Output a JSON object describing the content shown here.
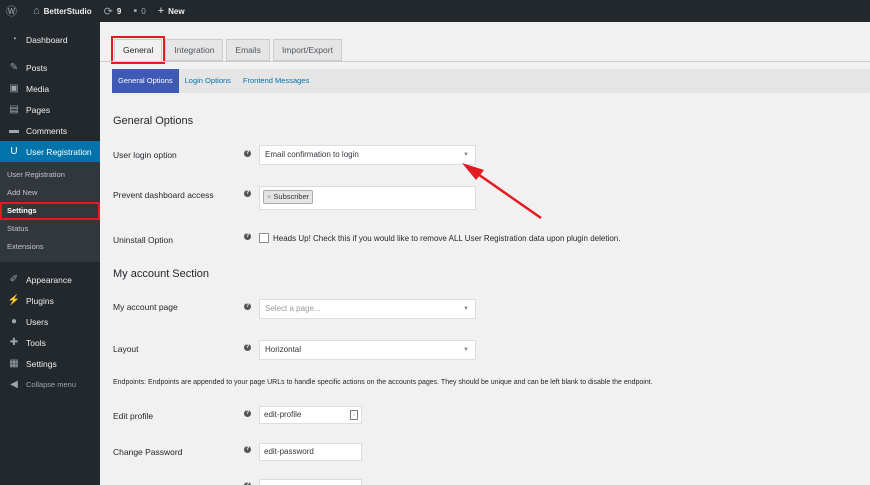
{
  "adminbar": {
    "site_name": "BetterStudio",
    "updates_count": "9",
    "comments_count": "0",
    "new_label": "New"
  },
  "sidebar": {
    "items": [
      {
        "label": "Dashboard",
        "icon": "dashboard-icon"
      },
      {
        "label": "Posts",
        "icon": "pin-icon"
      },
      {
        "label": "Media",
        "icon": "media-icon"
      },
      {
        "label": "Pages",
        "icon": "page-icon"
      },
      {
        "label": "Comments",
        "icon": "comment-icon"
      },
      {
        "label": "User Registration",
        "icon": "ur-icon"
      },
      {
        "label": "Appearance",
        "icon": "brush-icon"
      },
      {
        "label": "Plugins",
        "icon": "plug-icon"
      },
      {
        "label": "Users",
        "icon": "user-icon"
      },
      {
        "label": "Tools",
        "icon": "wrench-icon"
      },
      {
        "label": "Settings",
        "icon": "settings-icon"
      }
    ],
    "submenu": [
      "User Registration",
      "Add New",
      "Settings",
      "Status",
      "Extensions"
    ],
    "collapse_label": "Collapse menu"
  },
  "tabs": [
    "General",
    "Integration",
    "Emails",
    "Import/Export"
  ],
  "subnav": [
    "General Options",
    "Login Options",
    "Frontend Messages"
  ],
  "general": {
    "title": "General Options",
    "login_option_label": "User login option",
    "login_option_value": "Email confirmation to login",
    "prevent_access_label": "Prevent dashboard access",
    "prevent_access_tag": "Subscriber",
    "uninstall_label": "Uninstall Option",
    "uninstall_text": "Heads Up! Check this if you would like to remove ALL User Registration data upon plugin deletion."
  },
  "account": {
    "title": "My account Section",
    "page_label": "My account page",
    "page_placeholder": "Select a page...",
    "layout_label": "Layout",
    "layout_value": "Horizontal",
    "endpoints_note": "Endpoints: Endpoints are appended to your page URLs to handle specific actions on the accounts pages. They should be unique and can be left blank to disable the endpoint.",
    "edit_profile_label": "Edit profile",
    "edit_profile_value": "edit-profile",
    "change_password_label": "Change Password",
    "change_password_value": "edit-password"
  },
  "colors": {
    "highlight": "#e21b23",
    "accent": "#0073aa",
    "subnav_active": "#3e5ab4"
  }
}
